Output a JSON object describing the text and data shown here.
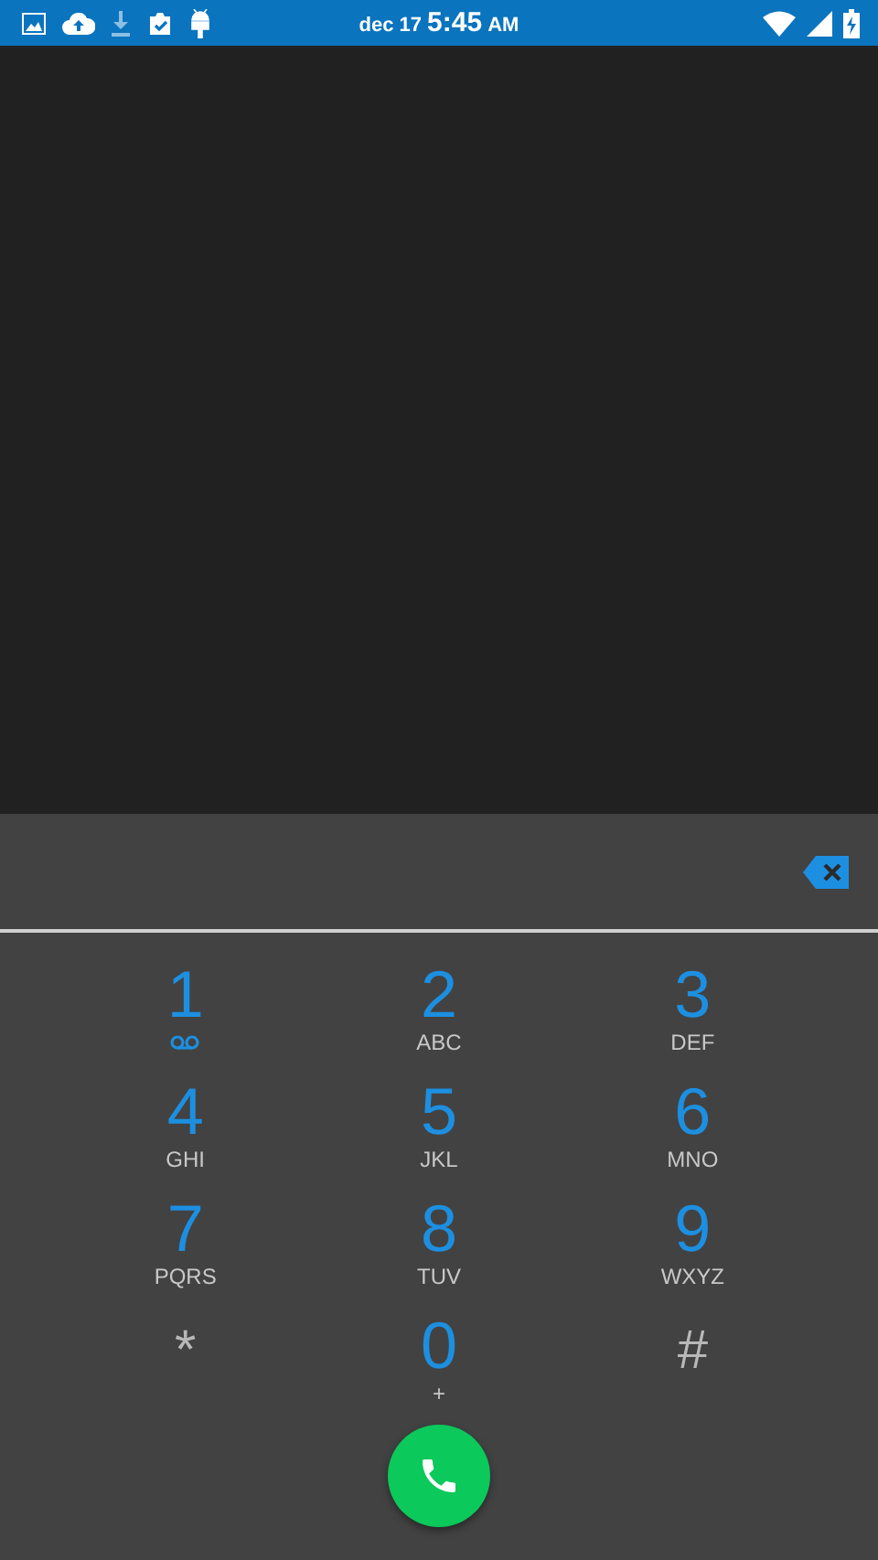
{
  "status_bar": {
    "date": "dec 17",
    "time": "5:45",
    "meridiem": "AM"
  },
  "keypad": [
    {
      "kind": "voicemail",
      "digit": "1"
    },
    {
      "kind": "letters",
      "digit": "2",
      "letters": "ABC"
    },
    {
      "kind": "letters",
      "digit": "3",
      "letters": "DEF"
    },
    {
      "kind": "letters",
      "digit": "4",
      "letters": "GHI"
    },
    {
      "kind": "letters",
      "digit": "5",
      "letters": "JKL"
    },
    {
      "kind": "letters",
      "digit": "6",
      "letters": "MNO"
    },
    {
      "kind": "letters",
      "digit": "7",
      "letters": "PQRS"
    },
    {
      "kind": "letters",
      "digit": "8",
      "letters": "TUV"
    },
    {
      "kind": "letters",
      "digit": "9",
      "letters": "WXYZ"
    },
    {
      "kind": "symbol",
      "digit": "*"
    },
    {
      "kind": "letters",
      "digit": "0",
      "letters": "+"
    },
    {
      "kind": "symbol",
      "digit": "#"
    }
  ]
}
